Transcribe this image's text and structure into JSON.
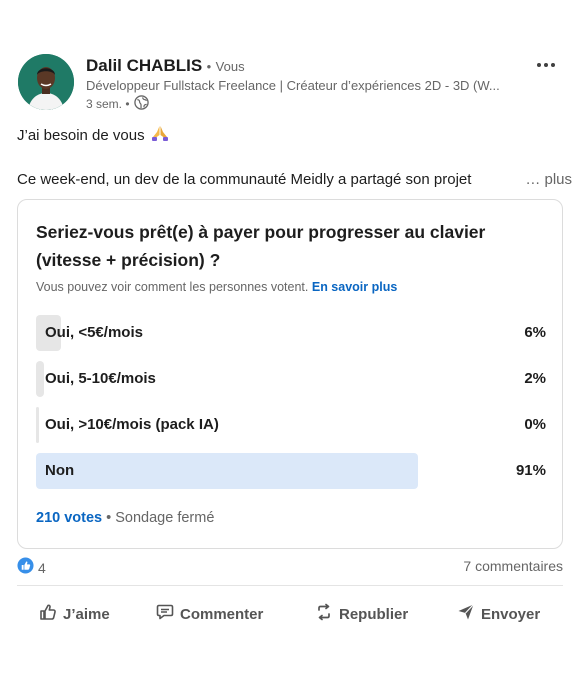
{
  "post": {
    "author": {
      "name": "Dalil CHABLIS",
      "sep": "•",
      "badge": "Vous",
      "headline": "Développeur Fullstack Freelance | Créateur d’expériences 2D - 3D (W...",
      "time": "3 sem. •"
    },
    "text_line1": "J’ai besoin de vous",
    "text_line2": "Ce week-end, un dev de la communauté Meidly a partagé son projet",
    "see_more": "… plus"
  },
  "poll": {
    "question": "Seriez-vous prêt(e) à payer pour progresser au clavier (vitesse + précision) ?",
    "note": "Vous pouvez voir comment les personnes votent.",
    "note_link": "En savoir plus",
    "options": [
      {
        "label": "Oui, <5€/mois",
        "percent": "6%",
        "fraction": 0.06,
        "color": "#e6e6e6"
      },
      {
        "label": "Oui, 5-10€/mois",
        "percent": "2%",
        "fraction": 0.02,
        "color": "#e6e6e6"
      },
      {
        "label": "Oui, >10€/mois (pack IA)",
        "percent": "0%",
        "fraction": 0.0,
        "color": "#e6e6e6"
      },
      {
        "label": "Non",
        "percent": "91%",
        "fraction": 0.91,
        "color": "#dbe8f9"
      }
    ],
    "votes": "210 votes",
    "status": "• Sondage fermé"
  },
  "social": {
    "reactions": "4",
    "comments": "7 commentaires"
  },
  "actions": {
    "like": "J’aime",
    "comment": "Commenter",
    "repost": "Republier",
    "send": "Envoyer"
  },
  "icons": {
    "more": "more-dots-icon",
    "globe": "globe-icon",
    "pray": "praying-hands-icon",
    "like_reaction": "like-reaction-icon",
    "like": "thumbs-up-icon",
    "comment": "comment-icon",
    "repost": "repost-icon",
    "send": "send-icon"
  },
  "colors": {
    "accent": "#0a66c2",
    "option_bar": "#e6e6e6",
    "selected_bar": "#dbe8f9"
  }
}
